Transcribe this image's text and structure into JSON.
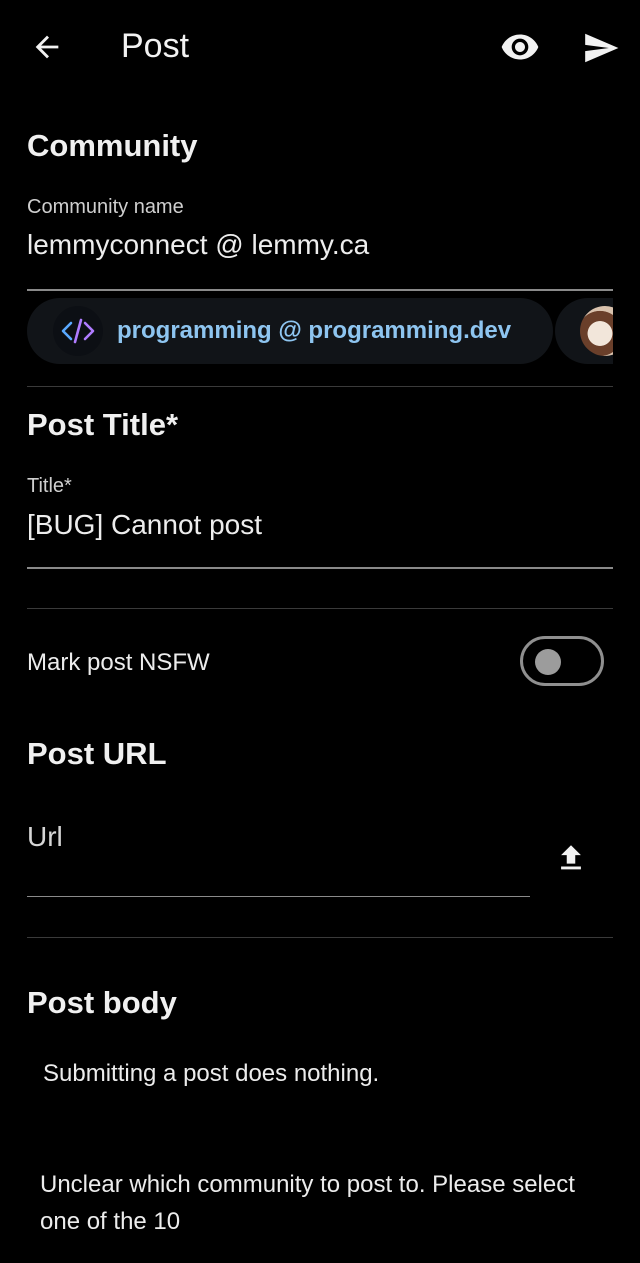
{
  "appbar": {
    "title": "Post",
    "back_icon": "arrow-left-icon",
    "preview_icon": "eye-icon",
    "send_icon": "send-icon"
  },
  "community": {
    "section_title": "Community",
    "field_label": "Community name",
    "field_value": "lemmyconnect @ lemmy.ca",
    "suggestions": [
      {
        "label": "programming @ programming.dev",
        "icon": "code-icon"
      },
      {
        "label": "",
        "icon": "avatar-image"
      }
    ]
  },
  "post_title": {
    "section_title": "Post Title*",
    "field_label": "Title*",
    "field_value": "[BUG] Cannot post"
  },
  "nsfw": {
    "label": "Mark post NSFW",
    "enabled": false
  },
  "post_url": {
    "section_title": "Post URL",
    "placeholder": "Url",
    "upload_icon": "upload-icon"
  },
  "post_body": {
    "section_title": "Post body",
    "lines": [
      "Submitting a post does nothing.",
      "Unclear which community to post to. Please select one of the 10"
    ]
  },
  "colors": {
    "background": "#000000",
    "accent_blue": "#8ec5f0",
    "code_purple": "#b07cff",
    "code_blue": "#5aa9ff"
  }
}
